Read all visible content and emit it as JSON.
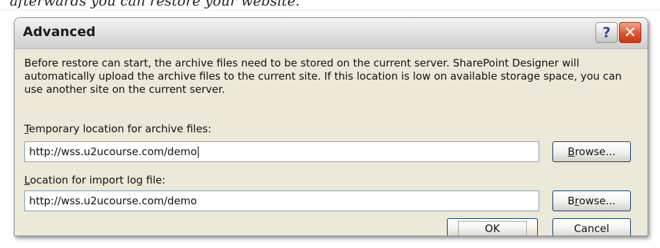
{
  "background": {
    "caption": "afterwards you can restore your website."
  },
  "dialog": {
    "title": "Advanced",
    "help_button": "?",
    "close_button": "✕",
    "description": "Before restore can start, the archive files need to be stored on the current server. SharePoint Designer will automatically upload the archive files to the current site. If this location is low on available storage space, you can use another site on the current server.",
    "temp_location": {
      "label_accel": "T",
      "label_rest": "emporary location for archive files:",
      "value": "http://wss.u2ucourse.com/demo",
      "browse_accel": "B",
      "browse_rest": "rowse..."
    },
    "log_location": {
      "label_accel": "L",
      "label_rest": "ocation for import log file:",
      "value": "http://wss.u2ucourse.com/demo",
      "browse_pre": "B",
      "browse_accel": "r",
      "browse_rest": "owse..."
    },
    "ok_label": "OK",
    "cancel_label": "Cancel"
  }
}
